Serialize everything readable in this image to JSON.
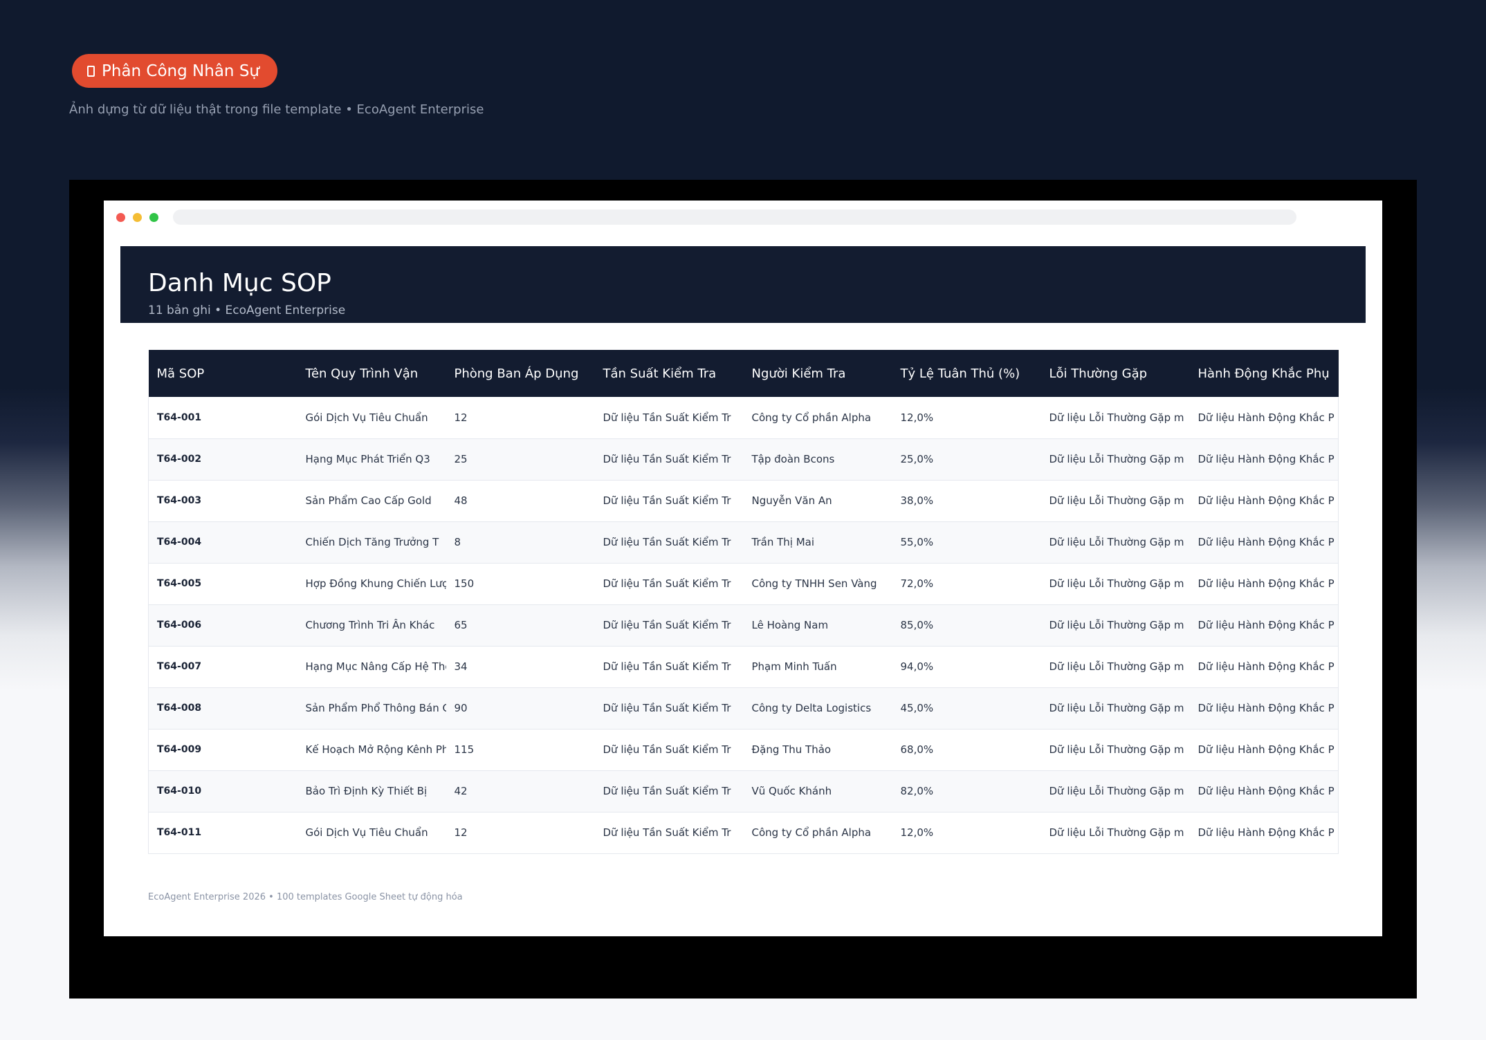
{
  "hero": {
    "badge_label": "Phân Công Nhân Sự",
    "badge_icon": "clipboard-icon",
    "subtitle": "Ảnh dựng từ dữ liệu thật trong file template • EcoAgent Enterprise"
  },
  "window": {
    "title": "Danh Mục SOP",
    "subtitle": "11 bản ghi • EcoAgent Enterprise",
    "footer": "EcoAgent Enterprise 2026 • 100 templates Google Sheet tự động hóa"
  },
  "table": {
    "columns": [
      "Mã SOP",
      "Tên Quy Trình Vận",
      "Phòng Ban Áp Dụng",
      "Tần Suất Kiểm Tra",
      "Người Kiểm Tra",
      "Tỷ Lệ Tuân Thủ (%)",
      "Lỗi Thường Gặp",
      "Hành Động Khắc Phụ"
    ],
    "rows": [
      [
        "T64-001",
        "Gói Dịch Vụ Tiêu Chuẩn",
        "12",
        "Dữ liệu Tần Suất Kiểm Tr",
        "Công ty Cổ phần Alpha",
        "12,0%",
        "Dữ liệu Lỗi Thường Gặp m",
        "Dữ liệu Hành Động Khắc P"
      ],
      [
        "T64-002",
        "Hạng Mục Phát Triển Q3",
        "25",
        "Dữ liệu Tần Suất Kiểm Tr",
        "Tập đoàn Bcons",
        "25,0%",
        "Dữ liệu Lỗi Thường Gặp m",
        "Dữ liệu Hành Động Khắc P"
      ],
      [
        "T64-003",
        "Sản Phẩm Cao Cấp Gold",
        "48",
        "Dữ liệu Tần Suất Kiểm Tr",
        "Nguyễn Văn An",
        "38,0%",
        "Dữ liệu Lỗi Thường Gặp m",
        "Dữ liệu Hành Động Khắc P"
      ],
      [
        "T64-004",
        "Chiến Dịch Tăng Trưởng T",
        "8",
        "Dữ liệu Tần Suất Kiểm Tr",
        "Trần Thị Mai",
        "55,0%",
        "Dữ liệu Lỗi Thường Gặp m",
        "Dữ liệu Hành Động Khắc P"
      ],
      [
        "T64-005",
        "Hợp Đồng Khung Chiến Lượ",
        "150",
        "Dữ liệu Tần Suất Kiểm Tr",
        "Công ty TNHH Sen Vàng",
        "72,0%",
        "Dữ liệu Lỗi Thường Gặp m",
        "Dữ liệu Hành Động Khắc P"
      ],
      [
        "T64-006",
        "Chương Trình Tri Ân Khác",
        "65",
        "Dữ liệu Tần Suất Kiểm Tr",
        "Lê Hoàng Nam",
        "85,0%",
        "Dữ liệu Lỗi Thường Gặp m",
        "Dữ liệu Hành Động Khắc P"
      ],
      [
        "T64-007",
        "Hạng Mục Nâng Cấp Hệ Thố",
        "34",
        "Dữ liệu Tần Suất Kiểm Tr",
        "Phạm Minh Tuấn",
        "94,0%",
        "Dữ liệu Lỗi Thường Gặp m",
        "Dữ liệu Hành Động Khắc P"
      ],
      [
        "T64-008",
        "Sản Phẩm Phổ Thông Bán C",
        "90",
        "Dữ liệu Tần Suất Kiểm Tr",
        "Công ty Delta Logistics",
        "45,0%",
        "Dữ liệu Lỗi Thường Gặp m",
        "Dữ liệu Hành Động Khắc P"
      ],
      [
        "T64-009",
        "Kế Hoạch Mở Rộng Kênh Ph",
        "115",
        "Dữ liệu Tần Suất Kiểm Tr",
        "Đặng Thu Thảo",
        "68,0%",
        "Dữ liệu Lỗi Thường Gặp m",
        "Dữ liệu Hành Động Khắc P"
      ],
      [
        "T64-010",
        "Bảo Trì Định Kỳ Thiết Bị",
        "42",
        "Dữ liệu Tần Suất Kiểm Tr",
        "Vũ Quốc Khánh",
        "82,0%",
        "Dữ liệu Lỗi Thường Gặp m",
        "Dữ liệu Hành Động Khắc P"
      ],
      [
        "T64-011",
        "Gói Dịch Vụ Tiêu Chuẩn",
        "12",
        "Dữ liệu Tần Suất Kiểm Tr",
        "Công ty Cổ phần Alpha",
        "12,0%",
        "Dữ liệu Lỗi Thường Gặp m",
        "Dữ liệu Hành Động Khắc P"
      ]
    ]
  },
  "colors": {
    "accent": "#e24b2f",
    "header_navy": "#131c30",
    "page_dark": "#101a2e"
  }
}
